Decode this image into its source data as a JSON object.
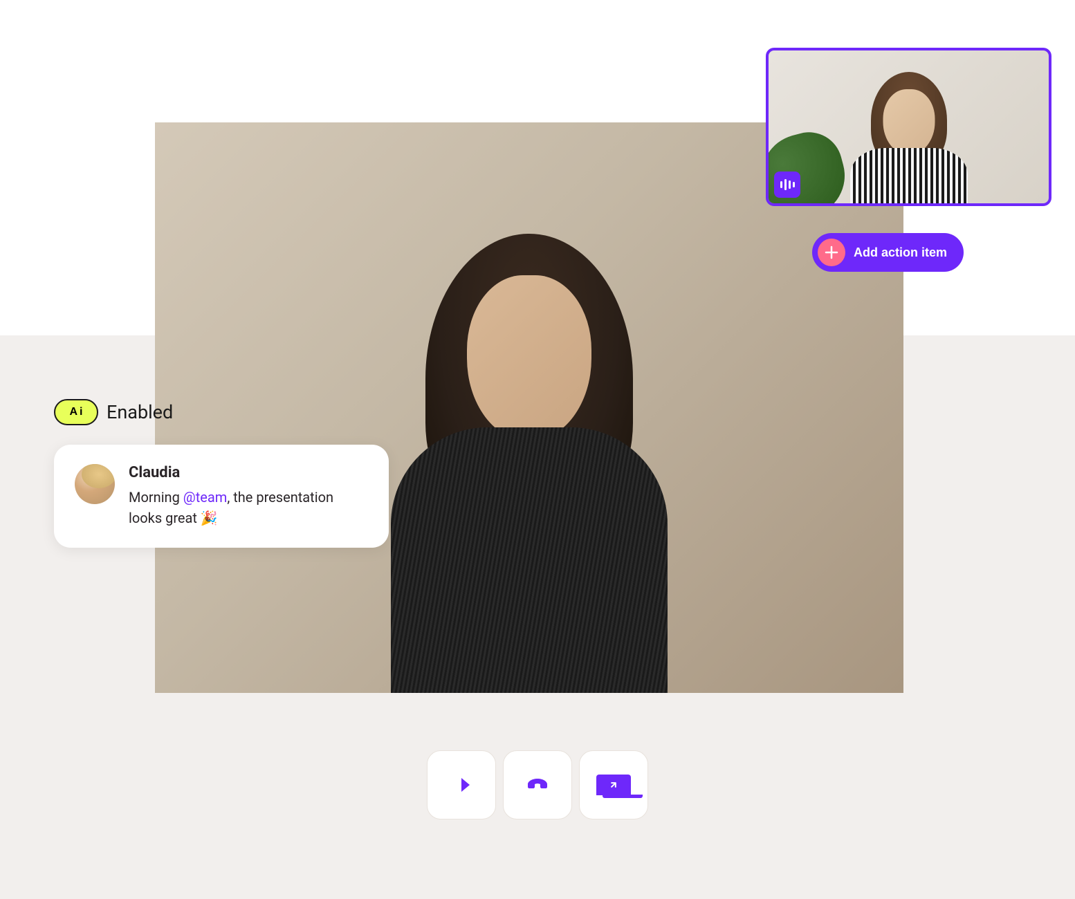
{
  "ai_badge": {
    "icon_text_a": "A",
    "icon_text_i": "i",
    "label": "Enabled"
  },
  "action_button": {
    "label": "Add action item"
  },
  "chat": {
    "name": "Claudia",
    "message_prefix": "Morning ",
    "mention": "@team",
    "message_suffix": ", the presentation looks great 🎉"
  },
  "colors": {
    "primary": "#6e28fa",
    "accent": "#ff6b8a",
    "ai_badge": "#e8ff5a"
  },
  "controls": {
    "video": "video-camera-icon",
    "end_call": "phone-hangup-icon",
    "share": "screen-share-icon"
  }
}
